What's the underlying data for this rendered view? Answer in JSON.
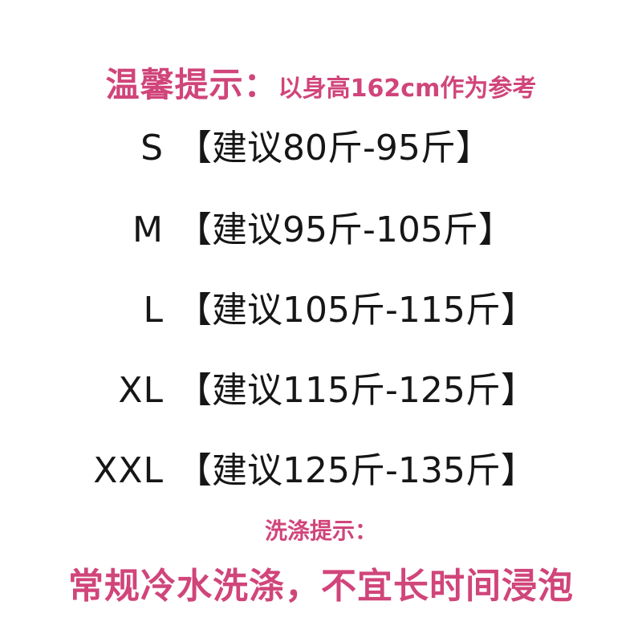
{
  "tip": {
    "title": "温馨提示：",
    "note": "以身高162cm作为参考"
  },
  "sizes": [
    {
      "code": "S",
      "range": "【建议80斤-95斤】"
    },
    {
      "code": "M",
      "range": "【建议95斤-105斤】"
    },
    {
      "code": "L",
      "range": "【建议105斤-115斤】"
    },
    {
      "code": "XL",
      "range": "【建议115斤-125斤】"
    },
    {
      "code": "XXL",
      "range": "【建议125斤-135斤】"
    }
  ],
  "wash": {
    "title": "洗涤提示：",
    "text": "常规冷水洗涤，不宜长时间浸泡"
  },
  "colors": {
    "accent": "#d0457a",
    "text": "#161616",
    "background": "#ffffff"
  }
}
